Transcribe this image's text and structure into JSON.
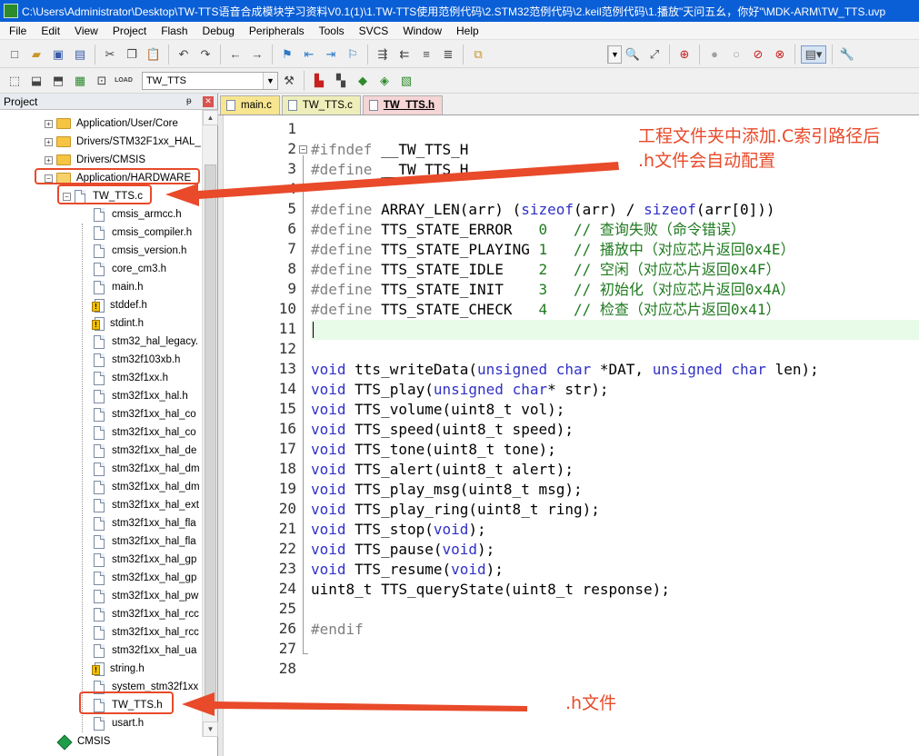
{
  "window": {
    "title": "C:\\Users\\Administrator\\Desktop\\TW-TTS语音合成模块学习资料V0.1(1)\\1.TW-TTS使用范例代码\\2.STM32范例代码\\2.keil范例代码\\1.播放\"天问五幺，你好\"\\MDK-ARM\\TW_TTS.uvp"
  },
  "menu": [
    "File",
    "Edit",
    "View",
    "Project",
    "Flash",
    "Debug",
    "Peripherals",
    "Tools",
    "SVCS",
    "Window",
    "Help"
  ],
  "toolbar": {
    "target_value": "TW_TTS",
    "load_label": "LOAD"
  },
  "project": {
    "title": "Project",
    "tree": [
      {
        "label": "Application/User/Core",
        "kind": "folder",
        "expander": "+"
      },
      {
        "label": "Drivers/STM32F1xx_HAL_",
        "kind": "folder",
        "expander": "+"
      },
      {
        "label": "Drivers/CMSIS",
        "kind": "folder",
        "expander": "+"
      },
      {
        "label": "Application/HARDWARE",
        "kind": "folder-open",
        "expander": "−"
      },
      {
        "label": "TW_TTS.c",
        "kind": "file",
        "expander": "−"
      },
      {
        "label": "cmsis_armcc.h",
        "kind": "file"
      },
      {
        "label": "cmsis_compiler.h",
        "kind": "file"
      },
      {
        "label": "cmsis_version.h",
        "kind": "file"
      },
      {
        "label": "core_cm3.h",
        "kind": "file"
      },
      {
        "label": "main.h",
        "kind": "file"
      },
      {
        "label": "stddef.h",
        "kind": "warn"
      },
      {
        "label": "stdint.h",
        "kind": "warn"
      },
      {
        "label": "stm32_hal_legacy.",
        "kind": "file"
      },
      {
        "label": "stm32f103xb.h",
        "kind": "file"
      },
      {
        "label": "stm32f1xx.h",
        "kind": "file"
      },
      {
        "label": "stm32f1xx_hal.h",
        "kind": "file"
      },
      {
        "label": "stm32f1xx_hal_co",
        "kind": "file"
      },
      {
        "label": "stm32f1xx_hal_co",
        "kind": "file"
      },
      {
        "label": "stm32f1xx_hal_de",
        "kind": "file"
      },
      {
        "label": "stm32f1xx_hal_dm",
        "kind": "file"
      },
      {
        "label": "stm32f1xx_hal_dm",
        "kind": "file"
      },
      {
        "label": "stm32f1xx_hal_ext",
        "kind": "file"
      },
      {
        "label": "stm32f1xx_hal_fla",
        "kind": "file"
      },
      {
        "label": "stm32f1xx_hal_fla",
        "kind": "file"
      },
      {
        "label": "stm32f1xx_hal_gp",
        "kind": "file"
      },
      {
        "label": "stm32f1xx_hal_gp",
        "kind": "file"
      },
      {
        "label": "stm32f1xx_hal_pw",
        "kind": "file"
      },
      {
        "label": "stm32f1xx_hal_rcc",
        "kind": "file"
      },
      {
        "label": "stm32f1xx_hal_rcc",
        "kind": "file"
      },
      {
        "label": "stm32f1xx_hal_ua",
        "kind": "file"
      },
      {
        "label": "string.h",
        "kind": "warn"
      },
      {
        "label": "system_stm32f1xx",
        "kind": "file"
      },
      {
        "label": "TW_TTS.h",
        "kind": "file"
      },
      {
        "label": "usart.h",
        "kind": "file"
      },
      {
        "label": "CMSIS",
        "kind": "gem"
      }
    ]
  },
  "tabs": [
    {
      "label": "main.c",
      "style": "yellow"
    },
    {
      "label": "TW_TTS.c",
      "style": "pale"
    },
    {
      "label": "TW_TTS.h",
      "style": "active"
    }
  ],
  "editor": {
    "current_line": 11,
    "lines": [
      "",
      "#ifndef __TW_TTS_H",
      "#define __TW_TTS_H",
      "",
      "#define ARRAY_LEN(arr) (sizeof(arr) / sizeof(arr[0]))",
      "#define TTS_STATE_ERROR   0   // 查询失败（命令错误）",
      "#define TTS_STATE_PLAYING 1   // 播放中（对应芯片返回0x4E）",
      "#define TTS_STATE_IDLE    2   // 空闲（对应芯片返回0x4F）",
      "#define TTS_STATE_INIT    3   // 初始化（对应芯片返回0x4A）",
      "#define TTS_STATE_CHECK   4   // 检查（对应芯片返回0x41）",
      "",
      "",
      "void tts_writeData(unsigned char *DAT, unsigned char len);",
      "void TTS_play(unsigned char* str);",
      "void TTS_volume(uint8_t vol);",
      "void TTS_speed(uint8_t speed);",
      "void TTS_tone(uint8_t tone);",
      "void TTS_alert(uint8_t alert);",
      "void TTS_play_msg(uint8_t msg);",
      "void TTS_play_ring(uint8_t ring);",
      "void TTS_stop(void);",
      "void TTS_pause(void);",
      "void TTS_resume(void);",
      "uint8_t TTS_queryState(uint8_t response);",
      "",
      "#endif",
      "",
      ""
    ]
  },
  "annotations": {
    "top_note_line1": "工程文件夹中添加.C索引路径后",
    "top_note_line2": ".h文件会自动配置",
    "bottom_note": ".h文件",
    "color": "#e84a2a"
  },
  "colors": {
    "titlebar": "#0b5fd6",
    "keyword": "#3030c8",
    "preprocessor": "#808080",
    "comment": "#1f7a1f",
    "current_line": "#e8fbe8"
  }
}
